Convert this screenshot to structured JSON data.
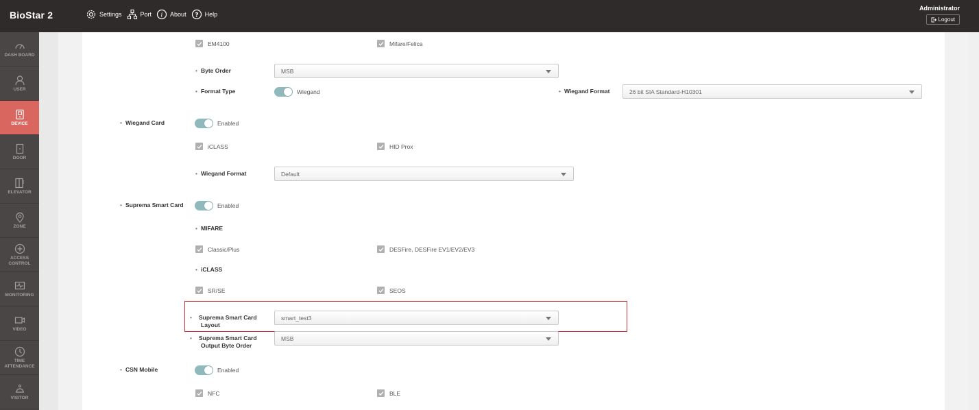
{
  "app": {
    "title": "BioStar 2"
  },
  "topnav": {
    "settings": "Settings",
    "port": "Port",
    "about": "About",
    "help": "Help"
  },
  "user": {
    "name": "Administrator",
    "logout": "Logout"
  },
  "sidebar": {
    "items": [
      {
        "label": "DASH BOARD",
        "icon": "dashboard-icon"
      },
      {
        "label": "USER",
        "icon": "user-icon"
      },
      {
        "label": "DEVICE",
        "icon": "device-icon",
        "active": true
      },
      {
        "label": "DOOR",
        "icon": "door-icon"
      },
      {
        "label": "ELEVATOR",
        "icon": "elevator-icon"
      },
      {
        "label": "ZONE",
        "icon": "zone-icon"
      },
      {
        "label": "ACCESS CONTROL",
        "icon": "access-control-icon"
      },
      {
        "label": "MONITORING",
        "icon": "monitoring-icon"
      },
      {
        "label": "VIDEO",
        "icon": "video-icon"
      },
      {
        "label": "TIME ATTENDANCE",
        "icon": "time-attendance-icon"
      },
      {
        "label": "VISITOR",
        "icon": "visitor-icon"
      }
    ]
  },
  "form": {
    "csn": {
      "em4100": "EM4100",
      "mifare_felica": "Mifare/Felica",
      "byte_order_label": "Byte Order",
      "byte_order_value": "MSB",
      "format_type_label": "Format Type",
      "format_type_value": "Wiegand",
      "wiegand_format_label": "Wiegand Format",
      "wiegand_format_value": "26 bit SIA Standard-H10301"
    },
    "wiegand_card": {
      "label": "Wiegand Card",
      "toggle": "Enabled",
      "iclass": "iCLASS",
      "hid_prox": "HID Prox",
      "format_label": "Wiegand Format",
      "format_value": "Default"
    },
    "suprema_smart_card": {
      "label": "Suprema Smart Card",
      "toggle": "Enabled",
      "mifare_heading": "MIFARE",
      "classic_plus": "Classic/Plus",
      "desfire": "DESFire, DESFire EV1/EV2/EV3",
      "iclass_heading": "iCLASS",
      "sr_se": "SR/SE",
      "seos": "SEOS",
      "layout_label": "Suprema Smart Card Layout",
      "layout_value": "smart_test3",
      "output_label": "Suprema Smart Card Output Byte Order",
      "output_value": "MSB"
    },
    "csn_mobile": {
      "label": "CSN Mobile",
      "toggle": "Enabled",
      "nfc": "NFC",
      "ble": "BLE"
    }
  },
  "colors": {
    "accent_active": "#d9675f",
    "toggle": "#8fb9bd",
    "highlight": "#d32f2f"
  }
}
